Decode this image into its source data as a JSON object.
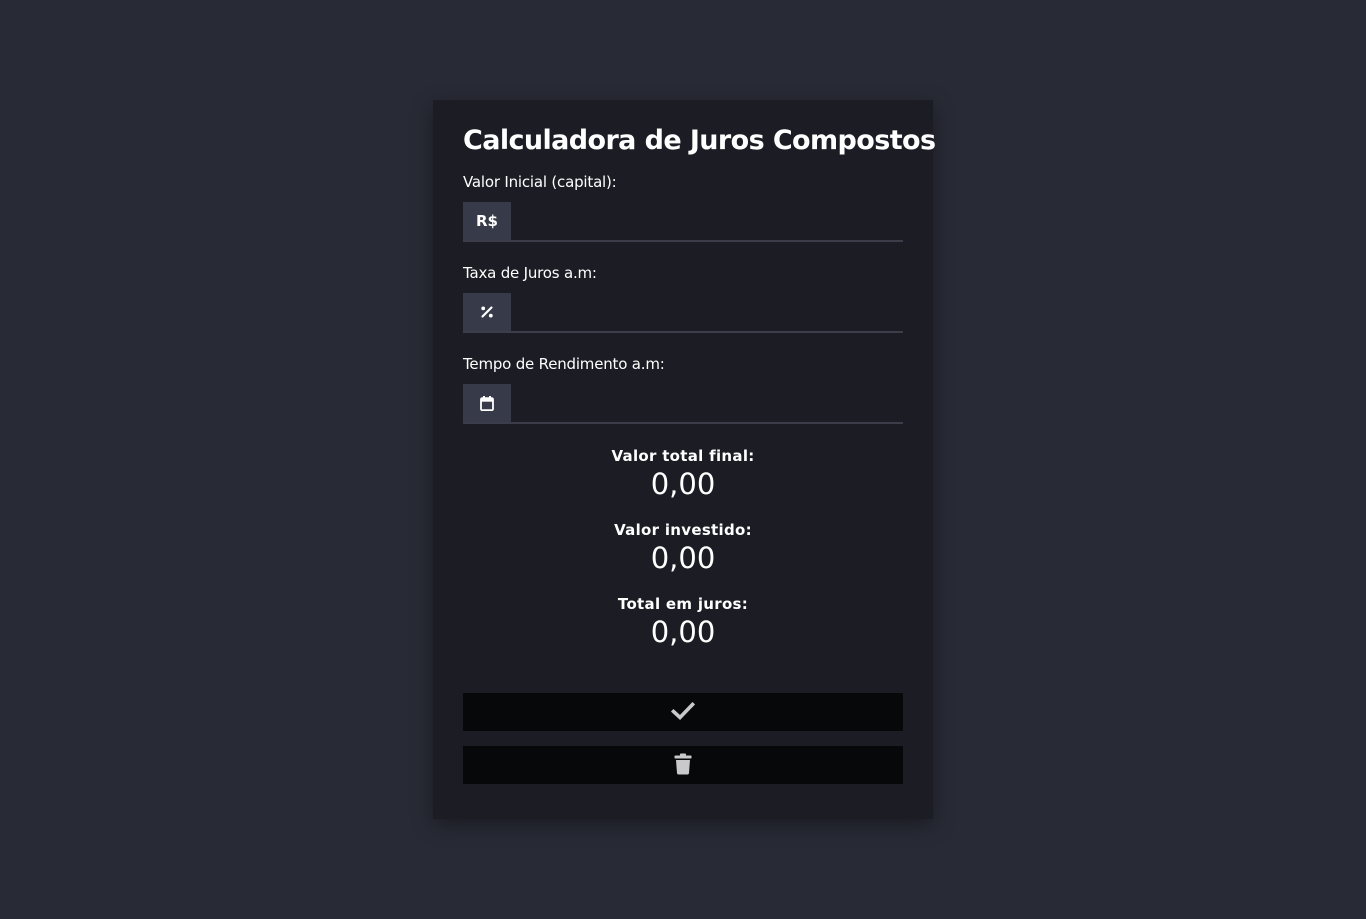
{
  "calculator": {
    "title": "Calculadora de Juros Compostos",
    "fields": [
      {
        "label": "Valor Inicial (capital):",
        "addon": "R$",
        "value": "",
        "placeholder": ""
      },
      {
        "label": "Taxa de Juros a.m:",
        "addon": "percent-icon",
        "value": "",
        "placeholder": ""
      },
      {
        "label": "Tempo de Rendimento a.m:",
        "addon": "calendar-icon",
        "value": "",
        "placeholder": ""
      }
    ],
    "results": [
      {
        "label": "Valor total final:",
        "value": "0,00"
      },
      {
        "label": "Valor investido:",
        "value": "0,00"
      },
      {
        "label": "Total em juros:",
        "value": "0,00"
      }
    ],
    "buttons": {
      "calculate_icon": "check-icon",
      "clear_icon": "trash-icon"
    }
  },
  "colors": {
    "page_background": "#282a35",
    "card_background": "#1b1c24",
    "addon_background": "#373a48",
    "button_background": "#07080a",
    "text": "#ffffff",
    "icon_muted": "#c9c9cc"
  }
}
